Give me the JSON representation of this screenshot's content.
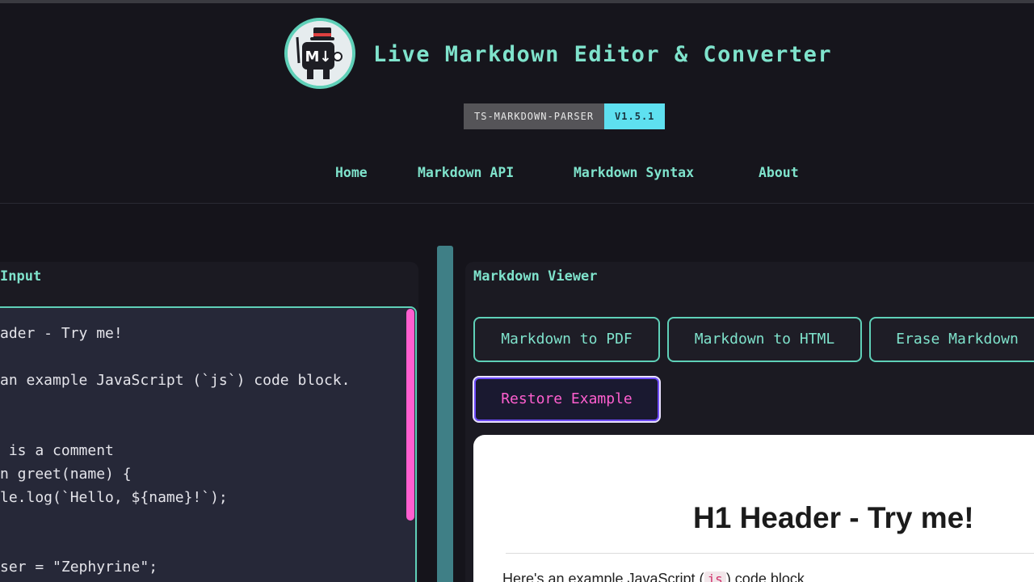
{
  "header": {
    "title": "Live Markdown Editor & Converter",
    "logo_text": "M↓",
    "badge_label": "TS-MARKDOWN-PARSER",
    "badge_version": "V1.5.1"
  },
  "nav": {
    "items": [
      {
        "label": "Home"
      },
      {
        "label": "Markdown API"
      },
      {
        "label": "Markdown Syntax"
      },
      {
        "label": "About"
      }
    ]
  },
  "editor": {
    "title": "Input",
    "lines": [
      "ader - Try me!",
      "an example JavaScript (`js`) code block.",
      " is a comment",
      "n greet(name) {",
      "le.log(`Hello, ${name}!`);",
      "ser = \"Zephyrine\";"
    ]
  },
  "viewer": {
    "title": "Markdown Viewer",
    "buttons": {
      "pdf": "Markdown to PDF",
      "html": "Markdown to HTML",
      "erase": "Erase Markdown",
      "restore": "Restore Example"
    },
    "preview": {
      "h1": "H1 Header - Try me!",
      "para_before": "Here's an example JavaScript (",
      "para_code": "js",
      "para_after": ") code block."
    }
  },
  "colors": {
    "accent": "#7fe3cc",
    "background": "#15141b",
    "pink": "#ff5fcf",
    "badge_cyan": "#5ee0f0"
  }
}
